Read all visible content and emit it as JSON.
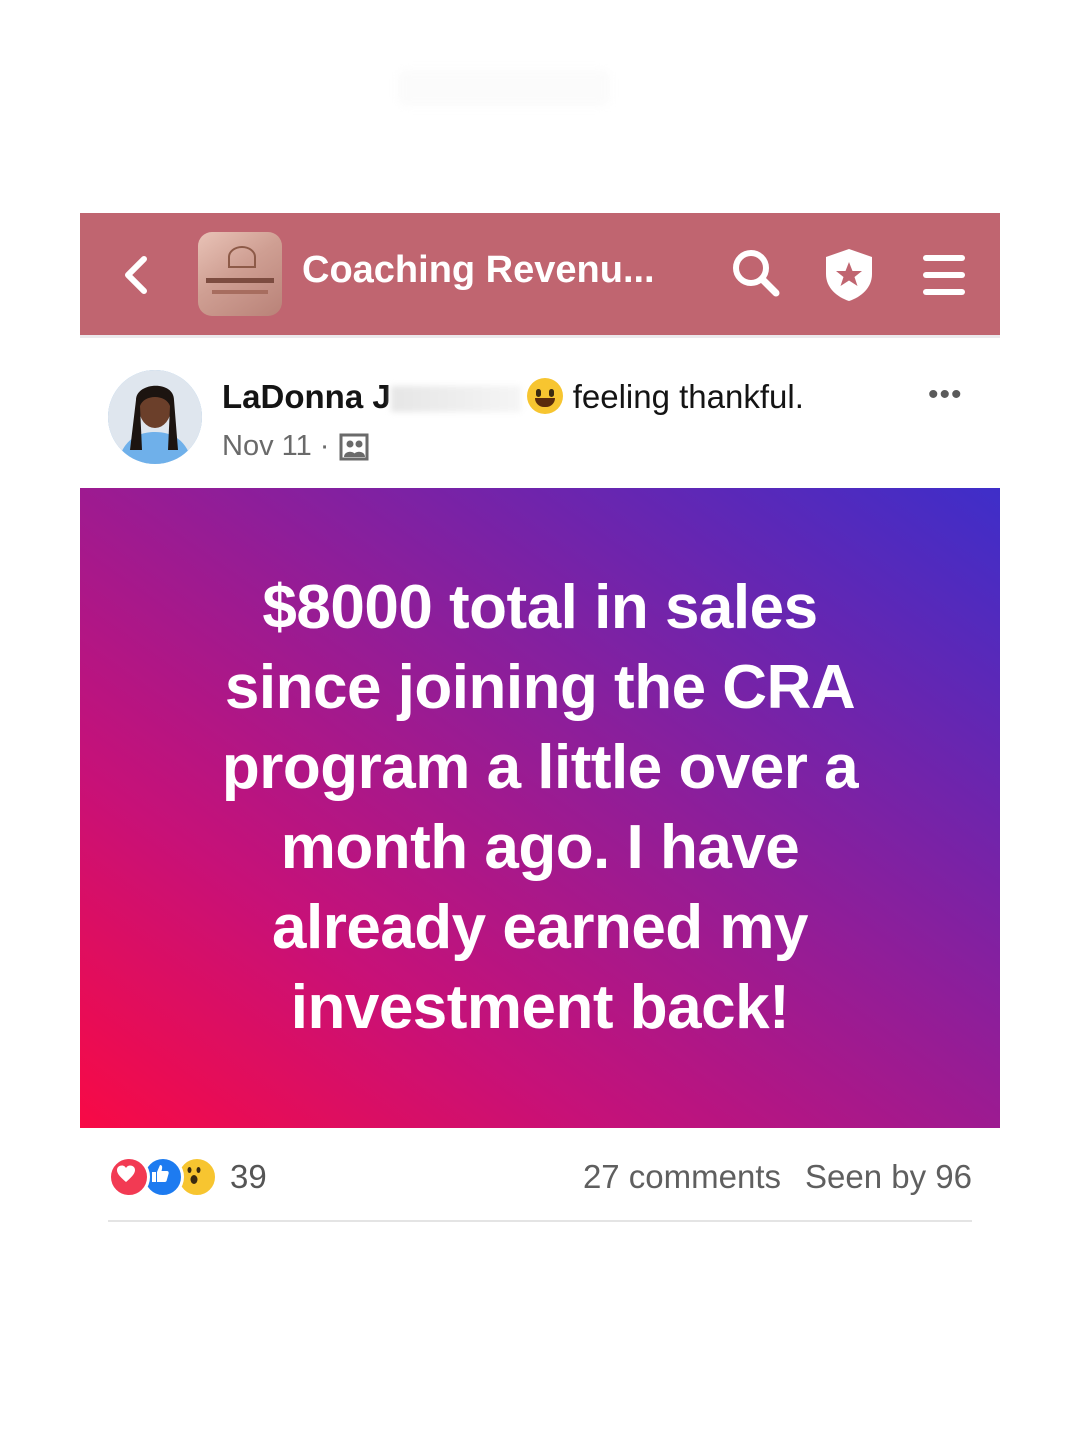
{
  "header": {
    "group_title": "Coaching Revenu...",
    "background_color": "#c06570",
    "icons": [
      "back-icon",
      "search-icon",
      "admin-shield-icon",
      "menu-icon"
    ]
  },
  "post": {
    "author_visible": "LaDonna J",
    "feeling_text": "feeling thankful.",
    "date": "Nov 11",
    "meta_separator": "·",
    "body": "$8000 total in sales since joining the CRA program a little over a month ago. I have already earned my investment back!",
    "more_label": "•••"
  },
  "footer": {
    "reaction_count": "39",
    "comments": "27 comments",
    "seen_by": "Seen by 96",
    "reaction_icons": [
      "love-reaction-icon",
      "like-reaction-icon",
      "wow-reaction-icon"
    ]
  }
}
